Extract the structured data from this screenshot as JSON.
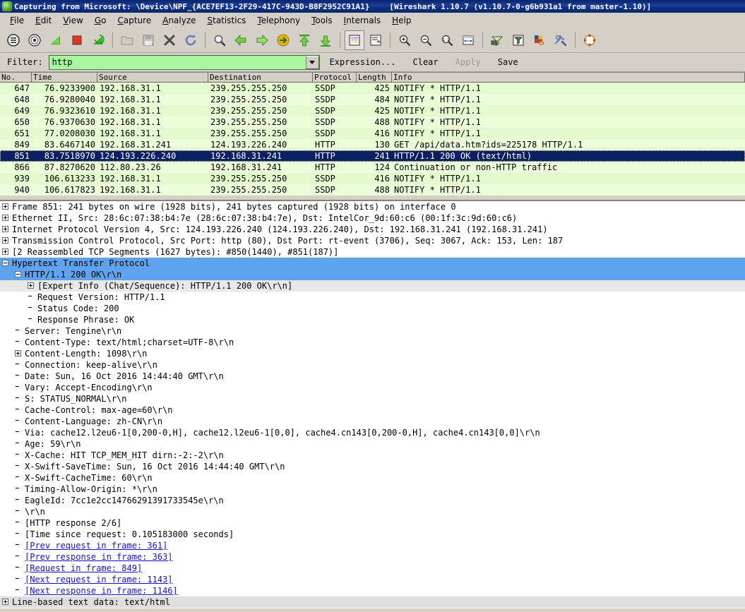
{
  "titlebar": {
    "icon": "wireshark-shark-fin-icon",
    "capture_text": "Capturing from Microsoft: \\Device\\NPF_{ACE7EF13-2F29-417C-943D-B8F2952C91A1}",
    "version_text": "[Wireshark 1.10.7  (v1.10.7-0-g6b931a1 from master-1.10)]"
  },
  "menubar": {
    "items": [
      {
        "label": "File",
        "mnemonic": "F"
      },
      {
        "label": "Edit",
        "mnemonic": "E"
      },
      {
        "label": "View",
        "mnemonic": "V"
      },
      {
        "label": "Go",
        "mnemonic": "G"
      },
      {
        "label": "Capture",
        "mnemonic": "C"
      },
      {
        "label": "Analyze",
        "mnemonic": "A"
      },
      {
        "label": "Statistics",
        "mnemonic": "S"
      },
      {
        "label": "Telephony",
        "mnemonic": "T"
      },
      {
        "label": "Tools",
        "mnemonic": "T"
      },
      {
        "label": "Internals",
        "mnemonic": "I"
      },
      {
        "label": "Help",
        "mnemonic": "H"
      }
    ]
  },
  "toolbar": {
    "buttons": [
      {
        "name": "interfaces-list-icon",
        "group": 1
      },
      {
        "name": "capture-options-icon",
        "group": 1
      },
      {
        "name": "start-capture-icon",
        "group": 1
      },
      {
        "name": "stop-capture-icon",
        "group": 1
      },
      {
        "name": "restart-capture-icon",
        "group": 1
      },
      {
        "name": "open-file-icon",
        "group": 2
      },
      {
        "name": "save-file-icon",
        "group": 2
      },
      {
        "name": "close-file-icon",
        "group": 2
      },
      {
        "name": "reload-file-icon",
        "group": 2
      },
      {
        "name": "find-packet-icon",
        "group": 3
      },
      {
        "name": "go-back-icon",
        "group": 3
      },
      {
        "name": "go-forward-icon",
        "group": 3
      },
      {
        "name": "go-to-packet-icon",
        "group": 3
      },
      {
        "name": "go-to-first-packet-icon",
        "group": 3
      },
      {
        "name": "go-to-last-packet-icon",
        "group": 3
      },
      {
        "name": "colorize-packets-icon",
        "group": 4,
        "pressed": true
      },
      {
        "name": "auto-scroll-icon",
        "group": 4
      },
      {
        "name": "zoom-in-icon",
        "group": 5
      },
      {
        "name": "zoom-out-icon",
        "group": 5
      },
      {
        "name": "zoom-reset-icon",
        "group": 5
      },
      {
        "name": "resize-columns-icon",
        "group": 5
      },
      {
        "name": "capture-filters-icon",
        "group": 6
      },
      {
        "name": "display-filters-icon",
        "group": 6
      },
      {
        "name": "coloring-rules-icon",
        "group": 6
      },
      {
        "name": "preferences-icon",
        "group": 6
      },
      {
        "name": "help-contents-icon",
        "group": 7
      }
    ]
  },
  "filterbar": {
    "label": "Filter:",
    "value": "http",
    "placeholder": "",
    "dropdown_icon": "chevron-down-icon",
    "expression_label": "Expression...",
    "clear_label": "Clear",
    "apply_label": "Apply",
    "save_label": "Save"
  },
  "packet_list": {
    "columns": [
      "No.",
      "Time",
      "Source",
      "Destination",
      "Protocol",
      "Length",
      "Info"
    ],
    "rows": [
      {
        "no": "647",
        "time": "76.9233900",
        "src": "192.168.31.1",
        "dst": "239.255.255.250",
        "proto": "SSDP",
        "len": "425",
        "info": "NOTIFY * HTTP/1.1",
        "selected": false
      },
      {
        "no": "648",
        "time": "76.9280040",
        "src": "192.168.31.1",
        "dst": "239.255.255.250",
        "proto": "SSDP",
        "len": "484",
        "info": "NOTIFY * HTTP/1.1",
        "selected": false
      },
      {
        "no": "649",
        "time": "76.9323610",
        "src": "192.168.31.1",
        "dst": "239.255.255.250",
        "proto": "SSDP",
        "len": "425",
        "info": "NOTIFY * HTTP/1.1",
        "selected": false
      },
      {
        "no": "650",
        "time": "76.9370630",
        "src": "192.168.31.1",
        "dst": "239.255.255.250",
        "proto": "SSDP",
        "len": "488",
        "info": "NOTIFY * HTTP/1.1",
        "selected": false
      },
      {
        "no": "651",
        "time": "77.0208030",
        "src": "192.168.31.1",
        "dst": "239.255.255.250",
        "proto": "SSDP",
        "len": "416",
        "info": "NOTIFY * HTTP/1.1",
        "selected": false
      },
      {
        "no": "849",
        "time": "83.6467140",
        "src": "192.168.31.241",
        "dst": "124.193.226.240",
        "proto": "HTTP",
        "len": "130",
        "info": "GET /api/data.htm?ids=225178 HTTP/1.1",
        "selected": false
      },
      {
        "no": "851",
        "time": "83.7518970",
        "src": "124.193.226.240",
        "dst": "192.168.31.241",
        "proto": "HTTP",
        "len": "241",
        "info": "HTTP/1.1 200 OK  (text/html)",
        "selected": true
      },
      {
        "no": "866",
        "time": "87.8270620",
        "src": "112.80.23.26",
        "dst": "192.168.31.241",
        "proto": "HTTP",
        "len": "124",
        "info": "Continuation or non-HTTP traffic",
        "selected": false
      },
      {
        "no": "939",
        "time": "106.613233",
        "src": "192.168.31.1",
        "dst": "239.255.255.250",
        "proto": "SSDP",
        "len": "416",
        "info": "NOTIFY * HTTP/1.1",
        "selected": false
      },
      {
        "no": "940",
        "time": "106.617823",
        "src": "192.168.31.1",
        "dst": "239.255.255.250",
        "proto": "SSDP",
        "len": "488",
        "info": "NOTIFY * HTTP/1.1",
        "selected": false
      }
    ]
  },
  "detail_tree": [
    {
      "indent": 0,
      "toggle": "plus",
      "text": "Frame 851: 241 bytes on wire (1928 bits), 241 bytes captured (1928 bits) on interface 0",
      "style": "normal"
    },
    {
      "indent": 0,
      "toggle": "plus",
      "text": "Ethernet II, Src: 28:6c:07:38:b4:7e (28:6c:07:38:b4:7e), Dst: IntelCor_9d:60:c6 (00:1f:3c:9d:60:c6)",
      "style": "normal"
    },
    {
      "indent": 0,
      "toggle": "plus",
      "text": "Internet Protocol Version 4, Src: 124.193.226.240 (124.193.226.240), Dst: 192.168.31.241 (192.168.31.241)",
      "style": "normal"
    },
    {
      "indent": 0,
      "toggle": "plus",
      "text": "Transmission Control Protocol, Src Port: http (80), Dst Port: rt-event (3706), Seq: 3067, Ack: 153, Len: 187",
      "style": "normal"
    },
    {
      "indent": 0,
      "toggle": "plus",
      "text": "[2 Reassembled TCP Segments (1627 bytes): #850(1440), #851(187)]",
      "style": "normal"
    },
    {
      "indent": 0,
      "toggle": "minus",
      "text": "Hypertext Transfer Protocol",
      "style": "highlight"
    },
    {
      "indent": 1,
      "toggle": "minus",
      "text": "HTTP/1.1 200 OK\\r\\n",
      "style": "highlight"
    },
    {
      "indent": 2,
      "toggle": "plus",
      "text": "[Expert Info (Chat/Sequence): HTTP/1.1 200 OK\\r\\n]",
      "style": "grey"
    },
    {
      "indent": 2,
      "toggle": "none",
      "text": "Request Version: HTTP/1.1",
      "style": "normal"
    },
    {
      "indent": 2,
      "toggle": "none",
      "text": "Status Code: 200",
      "style": "normal"
    },
    {
      "indent": 2,
      "toggle": "none",
      "text": "Response Phrase: OK",
      "style": "normal"
    },
    {
      "indent": 1,
      "toggle": "none",
      "text": "Server: Tengine\\r\\n",
      "style": "normal"
    },
    {
      "indent": 1,
      "toggle": "none",
      "text": "Content-Type: text/html;charset=UTF-8\\r\\n",
      "style": "normal"
    },
    {
      "indent": 1,
      "toggle": "plus",
      "text": "Content-Length: 1098\\r\\n",
      "style": "normal"
    },
    {
      "indent": 1,
      "toggle": "none",
      "text": "Connection: keep-alive\\r\\n",
      "style": "normal"
    },
    {
      "indent": 1,
      "toggle": "none",
      "text": "Date: Sun, 16 Oct 2016 14:44:40 GMT\\r\\n",
      "style": "normal"
    },
    {
      "indent": 1,
      "toggle": "none",
      "text": "Vary: Accept-Encoding\\r\\n",
      "style": "normal"
    },
    {
      "indent": 1,
      "toggle": "none",
      "text": "S: STATUS_NORMAL\\r\\n",
      "style": "normal"
    },
    {
      "indent": 1,
      "toggle": "none",
      "text": "Cache-Control: max-age=60\\r\\n",
      "style": "normal"
    },
    {
      "indent": 1,
      "toggle": "none",
      "text": "Content-Language: zh-CN\\r\\n",
      "style": "normal"
    },
    {
      "indent": 1,
      "toggle": "none",
      "text": "Via: cache12.l2eu6-1[0,200-0,H], cache12.l2eu6-1[0,0], cache4.cn143[0,200-0,H], cache4.cn143[0,0]\\r\\n",
      "style": "normal"
    },
    {
      "indent": 1,
      "toggle": "none",
      "text": "Age: 59\\r\\n",
      "style": "normal"
    },
    {
      "indent": 1,
      "toggle": "none",
      "text": "X-Cache: HIT TCP_MEM_HIT dirn:-2:-2\\r\\n",
      "style": "normal"
    },
    {
      "indent": 1,
      "toggle": "none",
      "text": "X-Swift-SaveTime: Sun, 16 Oct 2016 14:44:40 GMT\\r\\n",
      "style": "normal"
    },
    {
      "indent": 1,
      "toggle": "none",
      "text": "X-Swift-CacheTime: 60\\r\\n",
      "style": "normal"
    },
    {
      "indent": 1,
      "toggle": "none",
      "text": "Timing-Allow-Origin: *\\r\\n",
      "style": "normal"
    },
    {
      "indent": 1,
      "toggle": "none",
      "text": "EagleId: 7cc1e2cc14766291391733545e\\r\\n",
      "style": "normal"
    },
    {
      "indent": 1,
      "toggle": "none",
      "text": "\\r\\n",
      "style": "normal"
    },
    {
      "indent": 1,
      "toggle": "none",
      "text": "[HTTP response 2/6]",
      "style": "normal"
    },
    {
      "indent": 1,
      "toggle": "none",
      "text": "[Time since request: 0.105183000 seconds]",
      "style": "normal"
    },
    {
      "indent": 1,
      "toggle": "none",
      "text": "[Prev request in frame: 361]",
      "style": "link"
    },
    {
      "indent": 1,
      "toggle": "none",
      "text": "[Prev response in frame: 363]",
      "style": "link"
    },
    {
      "indent": 1,
      "toggle": "none",
      "text": "[Request in frame: 849]",
      "style": "link"
    },
    {
      "indent": 1,
      "toggle": "none",
      "text": "[Next request in frame: 1143]",
      "style": "link"
    },
    {
      "indent": 1,
      "toggle": "none",
      "text": "[Next response in frame: 1146]",
      "style": "link"
    },
    {
      "indent": 0,
      "toggle": "plus",
      "text": "Line-based text data: text/html",
      "style": "greybar"
    }
  ]
}
